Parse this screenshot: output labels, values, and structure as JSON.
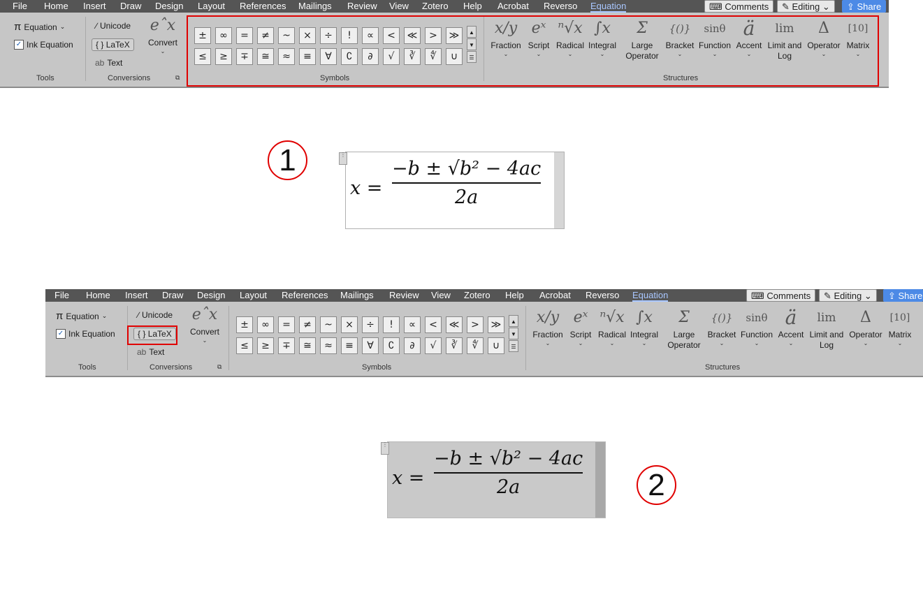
{
  "tabs": [
    "File",
    "Home",
    "Insert",
    "Draw",
    "Design",
    "Layout",
    "References",
    "Mailings",
    "Review",
    "View",
    "Zotero",
    "Help",
    "Acrobat",
    "Reverso",
    "Equation"
  ],
  "right_buttons": {
    "comments": "Comments",
    "editing": "Editing",
    "share": "Share"
  },
  "tools": {
    "equation": "Equation",
    "ink_equation": "Ink Equation",
    "label": "Tools"
  },
  "conversions": {
    "unicode": "Unicode",
    "latex": "LaTeX",
    "text": "Text",
    "convert": "Convert",
    "label": "Conversions"
  },
  "symbols": {
    "row1": [
      "±",
      "∞",
      "=",
      "≠",
      "~",
      "×",
      "÷",
      "!",
      "∝",
      "<",
      "≪",
      ">",
      "≫"
    ],
    "row2": [
      "≤",
      "≥",
      "∓",
      "≅",
      "≈",
      "≡",
      "∀",
      "∁",
      "∂",
      "√",
      "∛",
      "∜",
      "∪"
    ],
    "label": "Symbols"
  },
  "structures": {
    "items": [
      {
        "icon": "x/y",
        "label": "Fraction",
        "label2": ""
      },
      {
        "icon": "eˣ",
        "label": "Script",
        "label2": ""
      },
      {
        "icon": "ⁿ√x",
        "label": "Radical",
        "label2": ""
      },
      {
        "icon": "∫x",
        "label": "Integral",
        "label2": ""
      },
      {
        "icon": "Σ",
        "label": "Large",
        "label2": "Operator"
      },
      {
        "icon": "{()}",
        "label": "Bracket",
        "label2": ""
      },
      {
        "icon": "sinθ",
        "label": "Function",
        "label2": ""
      },
      {
        "icon": "ä",
        "label": "Accent",
        "label2": ""
      },
      {
        "icon": "lim",
        "label": "Limit and",
        "label2": "Log"
      },
      {
        "icon": "Δ",
        "label": "Operator",
        "label2": ""
      },
      {
        "icon": "[10]",
        "label": "Matrix",
        "label2": ""
      }
    ],
    "label": "Structures"
  },
  "callouts": {
    "one": "1",
    "two": "2"
  },
  "equation": {
    "lhs": "x =",
    "numerator": "−b ± √b² − 4ac",
    "denominator": "2a"
  },
  "colors": {
    "highlight": "#e00000",
    "ribbon_bg": "#c6c6c6",
    "tab_bar": "#555555",
    "active_tab": "#a9c7ff",
    "share_bg": "#4c8ae6"
  }
}
